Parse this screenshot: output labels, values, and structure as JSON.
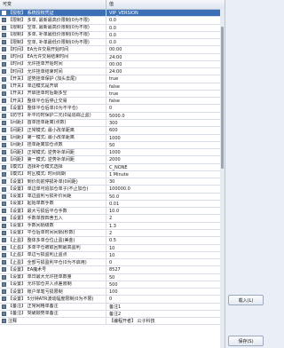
{
  "header": {
    "key_col": "可变",
    "value_col": "值"
  },
  "rows": [
    {
      "key": "【授权】 系统授权凭证",
      "value": "VIP_VERSION"
    },
    {
      "key": "【限制】 多单, 最新最高价限制(0为不限)",
      "value": "0.0"
    },
    {
      "key": "【限制】 空单, 最新最高价限制(0为不限)",
      "value": "0.0"
    },
    {
      "key": "【限制】 多单, 补单最低价限制(0为不限)",
      "value": "0.0"
    },
    {
      "key": "【限制】 空单, 补单最低价限制(0为不限)",
      "value": "0.0"
    },
    {
      "key": "【时间】 EA允许交易开始时间",
      "value": "00:00"
    },
    {
      "key": "【时间】 EA允许交易结束时间",
      "value": "24:00"
    },
    {
      "key": "【时间】 允许挂单开始时间",
      "value": "00:00"
    },
    {
      "key": "【时间】 允许挂单结束时间",
      "value": "24:00"
    },
    {
      "key": "【开关】 逆势挂单保护 (加头去尾)",
      "value": "true"
    },
    {
      "key": "【开关】 单边模式是开启",
      "value": "false"
    },
    {
      "key": "【开关】 开启挂单时后期多空",
      "value": "true"
    },
    {
      "key": "【开关】 整体平仓后停止交易",
      "value": "false"
    },
    {
      "key": "【设置】 整体平仓后单(0为不平仓)",
      "value": "0"
    },
    {
      "key": "【防守】 补平均时保护二元(0是追踪止盈)",
      "value": "5000.0"
    },
    {
      "key": "【间距】 首单挂单距离(点数)",
      "value": "300"
    },
    {
      "key": "【间距】 正常模式: 最小改单距离",
      "value": "600"
    },
    {
      "key": "【间距】 第一模式: 最小改单距离",
      "value": "1000"
    },
    {
      "key": "【间距】 挂单距离加仓点数",
      "value": "50"
    },
    {
      "key": "【间距】 正常模式: 逆势补单间距",
      "value": "1000"
    },
    {
      "key": "【间距】 第一模式: 逆势补单间距",
      "value": "2000"
    },
    {
      "key": "【模式】 选择补仓模式选择",
      "value": "C_NONE"
    },
    {
      "key": "【模式】 时区模式: 时间周期",
      "value": "1 Minute"
    },
    {
      "key": "【设置】 到价向前停损补单(0间距)",
      "value": "30"
    },
    {
      "key": "【设置】 单边单可追加仓单子(不止加仓)",
      "value": "100000.0"
    },
    {
      "key": "【设置】 单边盈利亏损补价间距",
      "value": "50.0"
    },
    {
      "key": "【设置】 起始单数手数",
      "value": "0.01"
    },
    {
      "key": "【设置】 最大亏损后平仓手数",
      "value": "10.0"
    },
    {
      "key": "【设置】 手数单按四舍五入",
      "value": "2"
    },
    {
      "key": "【设置】 手数间隔级数",
      "value": "1.3"
    },
    {
      "key": "【设置】 平仓后单时间间隔(秒数)",
      "value": "2"
    },
    {
      "key": "【止盈】 整体多单仓位止盈(美金)",
      "value": "0.5"
    },
    {
      "key": "【止盈】 多单平仓被取回到最高盈利",
      "value": "10"
    },
    {
      "key": "【止盈】 单边亏损盈利止盈点",
      "value": "10"
    },
    {
      "key": "【止盈】 全部亏损盈利平仓(0为不启用)",
      "value": "0"
    },
    {
      "key": "【设置】 EA魔术号",
      "value": "8527"
    },
    {
      "key": "【设置】 单日最大允许挂单数量",
      "value": "50"
    },
    {
      "key": "【设置】 允许加仓并入点差限制",
      "value": "500"
    },
    {
      "key": "【设置】 账户单笔亏损限制",
      "value": "100"
    },
    {
      "key": "【设置】 5分钟ATR波动幅度限制(0为不限)",
      "value": "0"
    },
    {
      "key": "【备注】 正常网格单备注",
      "value": "备注1"
    },
    {
      "key": "【备注】 突破顺势单备注",
      "value": "备注2"
    },
    {
      "key": "注释",
      "value": "【编程开者】 公子科技"
    }
  ],
  "selected_row": 0,
  "buttons": {
    "load": "载入(L)",
    "save": "保存(S)"
  }
}
